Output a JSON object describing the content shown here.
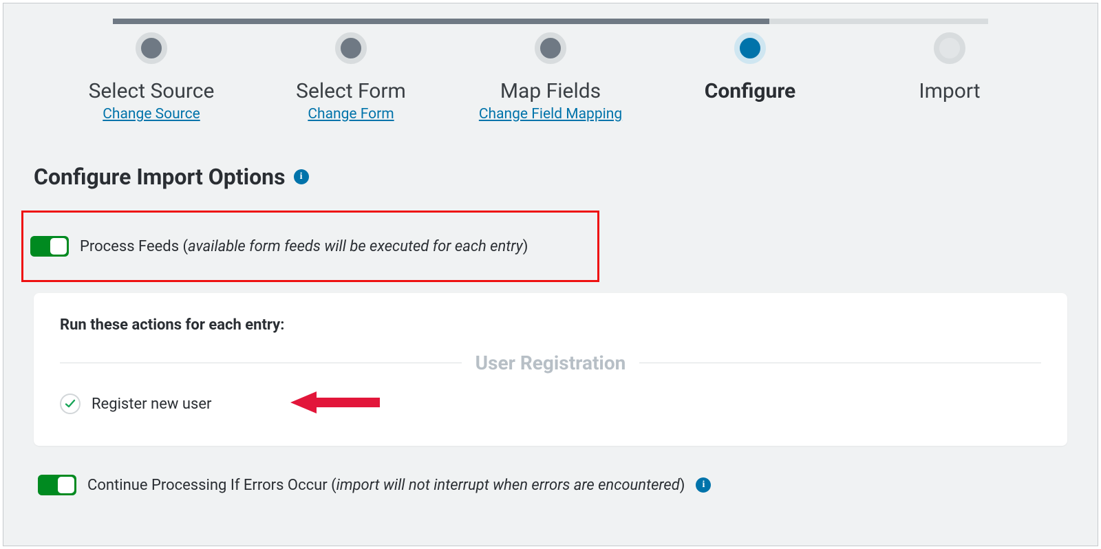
{
  "stepper": {
    "steps": [
      {
        "label": "Select Source",
        "link": "Change Source",
        "state": "done"
      },
      {
        "label": "Select Form",
        "link": "Change Form",
        "state": "done"
      },
      {
        "label": "Map Fields",
        "link": "Change Field Mapping",
        "state": "done"
      },
      {
        "label": "Configure",
        "link": "",
        "state": "active"
      },
      {
        "label": "Import",
        "link": "",
        "state": "pending"
      }
    ]
  },
  "heading": "Configure Import Options",
  "processFeeds": {
    "enabled": true,
    "labelPrefix": "Process Feeds (",
    "labelItalic": "available form feeds will be executed for each entry",
    "labelSuffix": ")"
  },
  "actionsCard": {
    "heading": "Run these actions for each entry:",
    "groupLabel": "User Registration",
    "items": [
      {
        "label": "Register new user",
        "checked": true
      }
    ]
  },
  "continueOnError": {
    "enabled": true,
    "labelPrefix": "Continue Processing If Errors Occur (",
    "labelItalic": "import will not interrupt when errors are encountered",
    "labelSuffix": ")"
  },
  "colors": {
    "accent": "#0073aa",
    "toggleOn": "#008a20",
    "stepDone": "#6f7984",
    "highlight": "#e11"
  }
}
